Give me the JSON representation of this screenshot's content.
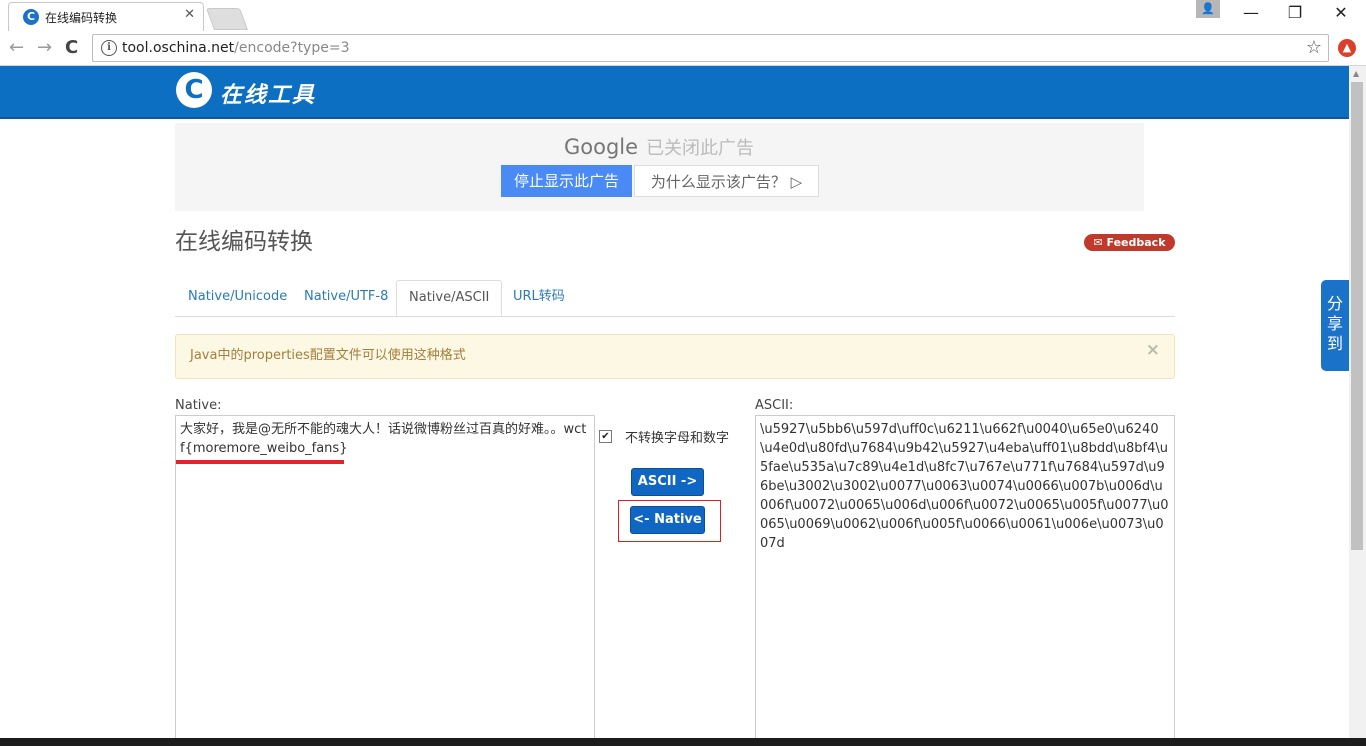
{
  "browser": {
    "tab_title": "在线编码转换",
    "favicon": "C",
    "tab_close_glyph": "✕",
    "url_host": "tool.oschina.net",
    "url_path": "/encode?type=3",
    "nav_back_glyph": "←",
    "nav_forward_glyph": "→",
    "reload_glyph": "C",
    "star_glyph": "☆",
    "info_glyph": "i",
    "ext_glyph": "▲",
    "user_glyph": "👤",
    "win_minimize": "—",
    "win_restore": "❐",
    "win_close": "✕"
  },
  "site": {
    "logo_letter": "C",
    "logo_text": "在线工具",
    "header_color": "#0c6fc2"
  },
  "ad": {
    "google_label": "Google",
    "closed_label": "已关闭此广告",
    "stop_button": "停止显示此广告",
    "why_button": "为什么显示该广告？ ▷"
  },
  "page": {
    "title": "在线编码转换",
    "feedback": "✉ Feedback",
    "share": "分享到"
  },
  "tabs": [
    {
      "label": "Native/Unicode",
      "active": false
    },
    {
      "label": "Native/UTF-8",
      "active": false
    },
    {
      "label": "Native/ASCII",
      "active": true
    },
    {
      "label": "URL转码",
      "active": false
    }
  ],
  "alert": {
    "text": "Java中的properties配置文件可以使用这种格式",
    "close_glyph": "×"
  },
  "native": {
    "label": "Native:",
    "value": "大家好，我是@无所不能的魂大人！话说微博粉丝过百真的好难。。wctf{moremore_weibo_fans}"
  },
  "options": {
    "checkbox_checked": true,
    "checkbox_glyph": "✔",
    "checkbox_label": "不转换字母和数字"
  },
  "buttons": {
    "to_ascii": "ASCII ->",
    "to_native": "<- Native"
  },
  "ascii": {
    "label": "ASCII:",
    "value": "\\u5927\\u5bb6\\u597d\\uff0c\\u6211\\u662f\\u0040\\u65e0\\u6240\\u4e0d\\u80fd\\u7684\\u9b42\\u5927\\u4eba\\uff01\\u8bdd\\u8bf4\\u5fae\\u535a\\u7c89\\u4e1d\\u8fc7\\u767e\\u771f\\u7684\\u597d\\u96be\\u3002\\u3002\\u0077\\u0063\\u0074\\u0066\\u007b\\u006d\\u006f\\u0072\\u0065\\u006d\\u006f\\u0072\\u0065\\u005f\\u0077\\u0065\\u0069\\u0062\\u006f\\u005f\\u0066\\u0061\\u006e\\u0073\\u007d"
  }
}
